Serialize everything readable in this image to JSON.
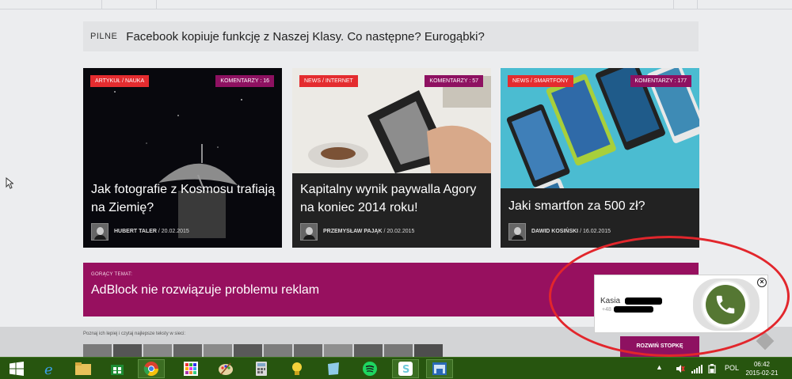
{
  "ticker": {
    "label": "PILNE",
    "headline": "Facebook kopiuje funkcję z Naszej Klasy. Co następne? Eurogąbki?"
  },
  "cards": [
    {
      "category": "ARTYKUŁ / NAUKA",
      "comments": "KOMENTARZY : 16",
      "headline": "Jak fotografie z Kosmosu trafiają na Ziemię?",
      "author": "HUBERT TALER",
      "date": " / 20.02.2015"
    },
    {
      "category": "NEWS / INTERNET",
      "comments": "KOMENTARZY : 57",
      "headline": "Kapitalny wynik paywalla Agory na koniec 2014 roku!",
      "author": "PRZEMYSŁAW PAJĄK",
      "date": " / 20.02.2015"
    },
    {
      "category": "NEWS / SMARTFONY",
      "comments": "KOMENTARZY : 177",
      "headline": "Jaki smartfon za 500 zł?",
      "author": "DAWID KOSIŃSKI",
      "date": " / 16.02.2015"
    }
  ],
  "hot_topic": {
    "kicker": "GORĄCY TEMAT:",
    "title": "AdBlock nie rozwiązuje problemu reklam"
  },
  "footer": {
    "intro": "Poznaj ich lepiej i czytaj najlepsze teksty w sieci:",
    "expand_label": "ROZWIŃ STOPKĘ"
  },
  "call_widget": {
    "name": "Kasia",
    "phone_prefix": "+48"
  },
  "taskbar": {
    "language": "POL",
    "time": "06:42",
    "date": "2015-02-21"
  },
  "colors": {
    "accent_magenta": "#8e1161",
    "category_red": "#e42c2f",
    "taskbar_green": "#27550f",
    "call_green": "#557733",
    "annotation_red": "#e2262c"
  }
}
